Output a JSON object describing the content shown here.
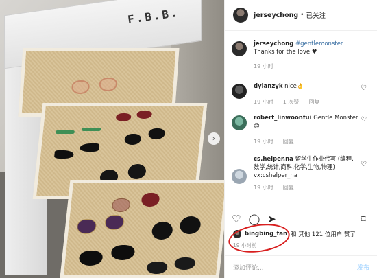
{
  "header": {
    "username": "jerseychong",
    "separator": "•",
    "follow_label": "已关注"
  },
  "photo": {
    "box_label": "F.B.B.",
    "next_arrow": "›"
  },
  "comments": [
    {
      "username": "jerseychong",
      "hashtag": "#gentlemonster",
      "text": "Thanks for the love ♥",
      "time": "19 小时"
    },
    {
      "username": "dylanzyk",
      "text": "nice👌",
      "time": "19 小时",
      "likes": "1 次赞",
      "reply": "回复"
    },
    {
      "username": "robert_linwoonfui",
      "text": "Gentle Monster 😊",
      "time": "19 小时",
      "reply": "回复"
    },
    {
      "username": "cs.helper.na",
      "text": "留学生作业代写 (编程,数学,统计,商科,化学,生物,物理) vx:cshelper_na",
      "time": "19 小时",
      "reply": "回复"
    }
  ],
  "likes": {
    "username": "bingbing_fan",
    "and_text": "和 其他 121 位用户 赞了"
  },
  "time_ago": "19 小时前",
  "add_comment": {
    "placeholder": "添加评论...",
    "post_label": "发布"
  },
  "colors": {
    "highlight_circle": "#d81f1f",
    "hashtag": "#3a6fa3"
  }
}
